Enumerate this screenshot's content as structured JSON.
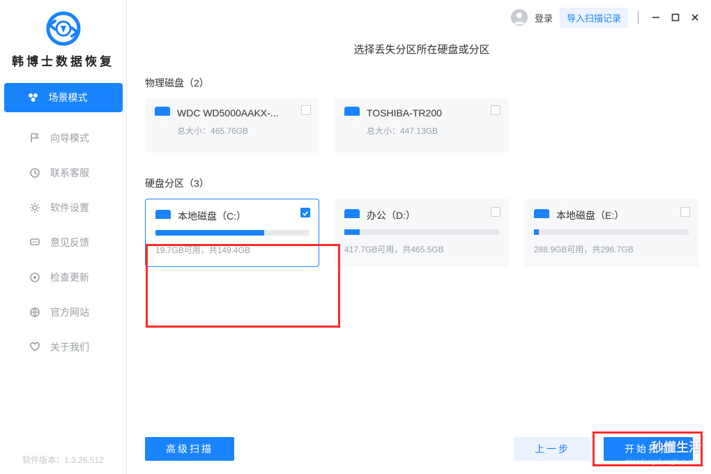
{
  "brand": {
    "name": "韩博士数据恢复"
  },
  "sidebar": {
    "items": [
      {
        "label": "场景模式"
      },
      {
        "label": "向导模式"
      },
      {
        "label": "联系客服"
      },
      {
        "label": "软件设置"
      },
      {
        "label": "意见反馈"
      },
      {
        "label": "检查更新"
      },
      {
        "label": "官方网站"
      },
      {
        "label": "关于我们"
      }
    ],
    "version_prefix": "软件版本：",
    "version": "1.3.26.512"
  },
  "header": {
    "login": "登录",
    "import": "导入扫描记录"
  },
  "page": {
    "title": "选择丢失分区所在硬盘或分区",
    "physical_label": "物理磁盘（2）",
    "partition_label": "硬盘分区（3）"
  },
  "disks": [
    {
      "name": "WDC WD5000AAKX-...",
      "size_prefix": "总大小：",
      "size": "465.76GB"
    },
    {
      "name": "TOSHIBA-TR200",
      "size_prefix": "总大小：",
      "size": "447.13GB"
    }
  ],
  "partitions": [
    {
      "name": "本地磁盘（C:）",
      "free": "19.7GB可用，共149.4GB",
      "fill_pct": 71,
      "selected": true
    },
    {
      "name": "办公（D:）",
      "free": "417.7GB可用，共465.5GB",
      "fill_pct": 10,
      "selected": false
    },
    {
      "name": "本地磁盘（E:）",
      "free": "288.9GB可用，共296.7GB",
      "fill_pct": 3,
      "selected": false
    }
  ],
  "footer": {
    "advanced": "高级扫描",
    "prev": "上一步",
    "start": "开始扫描"
  },
  "watermark": {
    "text": "秒懂生活",
    "url": "miaodongshenghuo.com"
  }
}
